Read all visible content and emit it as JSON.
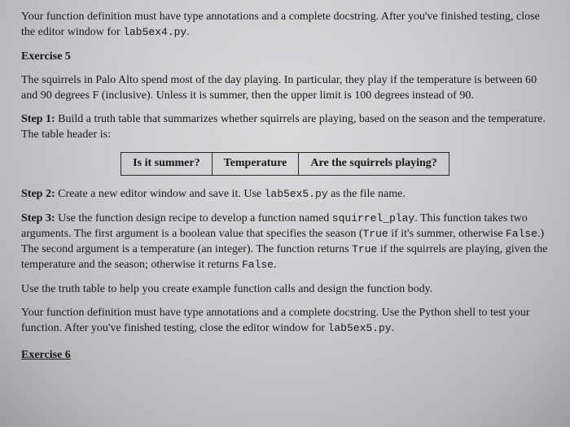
{
  "intro": {
    "line": "Your function definition must have type annotations and a complete docstring. After you've finished testing, close the editor window for ",
    "file": "lab5ex4.py",
    "tail": "."
  },
  "ex5_heading": "Exercise 5",
  "problem": {
    "p1": "The squirrels in Palo Alto spend most of the day playing. In particular, they play if the temperature is between 60 and 90 degrees F (inclusive). Unless it is summer, then the upper limit is 100 degrees instead of 90."
  },
  "step1": {
    "label": "Step 1:",
    "text": " Build a truth table that summarizes whether squirrels are playing, based on the season and the temperature. The table header is:"
  },
  "table": {
    "h1": "Is it summer?",
    "h2": "Temperature",
    "h3": "Are the squirrels playing?"
  },
  "step2": {
    "label": "Step 2:",
    "text_a": " Create a new editor window and save it. Use ",
    "file": "lab5ex5.py",
    "text_b": " as the file name."
  },
  "step3": {
    "label": "Step 3:",
    "text_a": " Use the function design recipe to develop a function named ",
    "fn": "squirrel_play",
    "text_b": ". This function takes two arguments. The first argument is a boolean value that specifies the season (",
    "true": "True",
    "text_c": " if it's summer, otherwise ",
    "false1": "False",
    "text_d": ".) The second argument is a temperature (an integer). The function returns ",
    "true2": "True",
    "text_e": " if the squirrels are playing, given the temperature and the season; otherwise it returns ",
    "false2": "False",
    "text_f": "."
  },
  "use_truth": "Use the truth table to help you create example function calls and design the function body.",
  "closing": {
    "a": "Your function definition must have type annotations and a complete docstring. Use the Python shell to test your function. After you've finished testing, close the editor window for ",
    "file": "lab5ex5.py",
    "b": "."
  },
  "ex6_heading": "Exercise 6"
}
